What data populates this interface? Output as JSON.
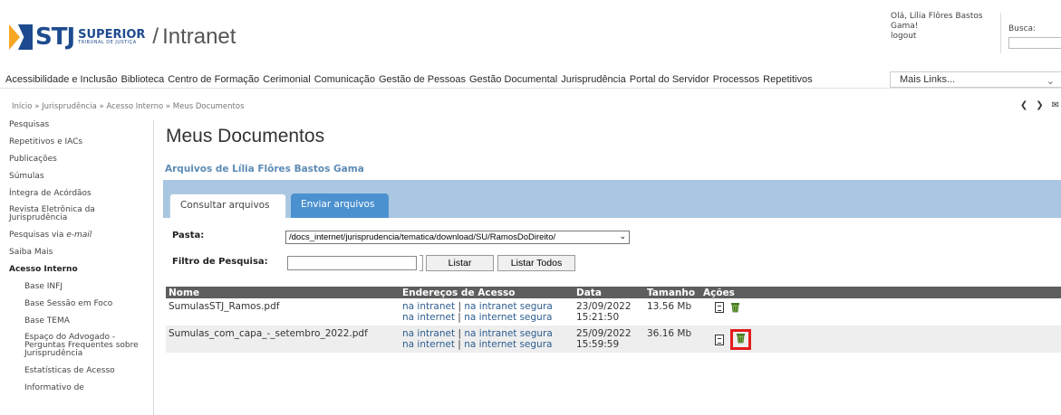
{
  "header": {
    "logo_stj": "STJ",
    "logo_superior": "SUPERIOR",
    "logo_tribunal": "TRIBUNAL DE JUSTIÇA",
    "logo_slash": "/",
    "logo_intranet": "Intranet",
    "greeting_line1": "Olá, Lília Flôres Bastos",
    "greeting_line2": "Gama!",
    "logout": "logout",
    "search_label": "Busca:"
  },
  "nav": {
    "items": [
      "Acessibilidade e Inclusão",
      "Biblioteca",
      "Centro de Formação",
      "Cerimonial",
      "Comunicação",
      "Gestão de Pessoas",
      "Gestão Documental",
      "Jurisprudência",
      "Portal do Servidor",
      "Processos",
      "Repetitivos"
    ],
    "mais_links": "Mais Links...",
    "mais_arrow": "⌄"
  },
  "breadcrumb": {
    "items": [
      "Início",
      "Jurisprudência",
      "Acesso Interno",
      "Meus Documentos"
    ],
    "sep": "»"
  },
  "pager": {
    "prev": "❮",
    "next": "❯",
    "mail": "✉"
  },
  "sidebar": {
    "items": [
      "Pesquisas",
      "Repetitivos e IACs",
      "Publicações",
      "Súmulas",
      "Íntegra de Acórdãos"
    ],
    "revista_line1": "Revista Eletrônica da",
    "revista_line2": "Jurisprudência",
    "pesquisas_email_prefix": "Pesquisas via ",
    "pesquisas_email_em": "e-mail",
    "saiba_mais": "Saiba Mais",
    "acesso_interno": "Acesso Interno",
    "sub_items": [
      "Base INFJ",
      "Base Sessão em Foco",
      "Base TEMA"
    ],
    "espaco_line1": "Espaço do Advogado -",
    "espaco_line2": "Perguntas Frequentes sobre",
    "espaco_line3": "Jurisprudência",
    "estatisticas": "Estatísticas de Acesso",
    "informativo": "Informativo de"
  },
  "main": {
    "title": "Meus Documentos",
    "owner": "Arquivos de Lília Flôres Bastos Gama",
    "tab_active": "Consultar arquivos",
    "tab_inactive": "Enviar arquivos",
    "pasta_label": "Pasta:",
    "pasta_value": "/docs_internet/jurisprudencia/tematica/download/SU/RamosDoDireito/",
    "filtro_label": "Filtro de Pesquisa:",
    "filtro_value": "",
    "listar": "Listar",
    "listar_todos": "Listar Todos"
  },
  "table": {
    "headers": [
      "Nome",
      "Endereços de Acesso",
      "Data",
      "Tamanho",
      "Ações"
    ],
    "link_intranet": "na intranet",
    "link_intranet_segura": "na intranet segura",
    "link_internet": "na internet",
    "link_internet_segura": "na internet segura",
    "pipe": "|",
    "rows": [
      {
        "name": "SumulasSTJ_Ramos.pdf",
        "date": "23/09/2022",
        "time": "15:21:50",
        "size": "13.56 Mb"
      },
      {
        "name": "Sumulas_com_capa_-_setembro_2022.pdf",
        "date": "25/09/2022",
        "time": "15:59:59",
        "size": "36.16 Mb"
      }
    ]
  },
  "colors": {
    "accent": "#a9c7e2",
    "tab_blue": "#4c91cf",
    "header_gray": "#5e5e5e",
    "highlight": "#e41c1c",
    "brand": "#1e4b8f"
  }
}
